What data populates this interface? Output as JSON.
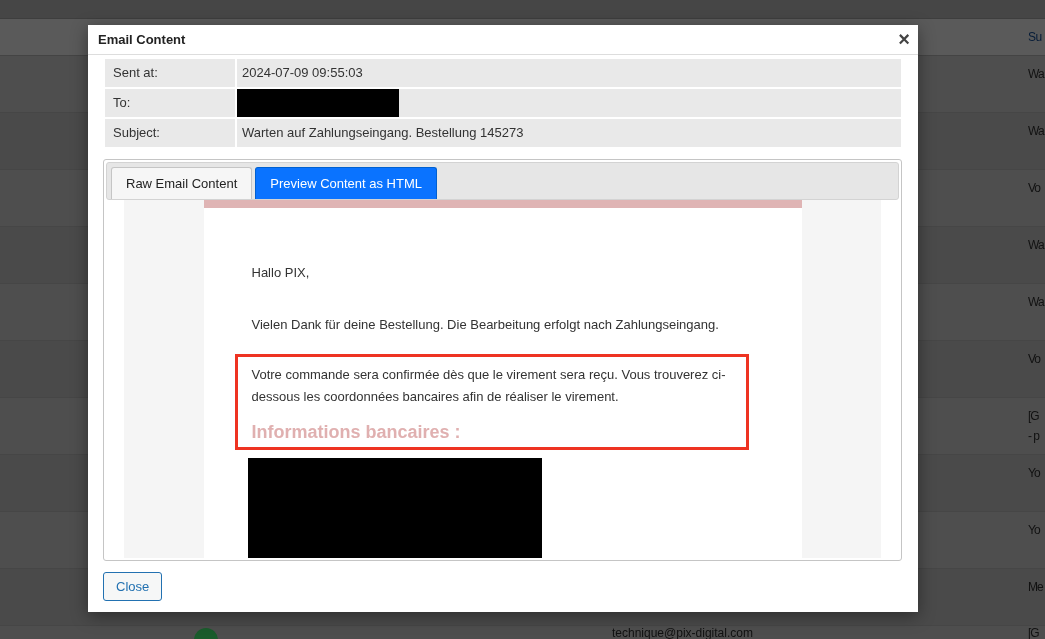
{
  "background_table": {
    "header": "Su",
    "rows": [
      {
        "column_1": "Wa"
      },
      {
        "column_1": "Wa"
      },
      {
        "column_1": "Vo"
      },
      {
        "column_1": "Wa"
      },
      {
        "column_1": "Wa"
      },
      {
        "column_1": "Vo"
      },
      {
        "column_1": "[G\n- p"
      },
      {
        "column_1": "Yo"
      },
      {
        "column_1": "Yo"
      },
      {
        "column_1": "Me"
      },
      {
        "column_1": "[G",
        "email": "technique@pix-digital.com"
      }
    ]
  },
  "dialog": {
    "title": "Email Content",
    "close_icon": "×",
    "fields": [
      {
        "label": "Sent at:",
        "value": "2024-07-09 09:55:03",
        "redacted": false
      },
      {
        "label": "To:",
        "redacted": true
      },
      {
        "label": "Subject:",
        "value": "Warten auf Zahlungseingang. Bestellung 145273",
        "redacted": false
      }
    ],
    "tabs": [
      {
        "label": "Raw Email Content",
        "selected": false
      },
      {
        "label": "Preview Content as HTML",
        "selected": true
      }
    ],
    "email": [
      {
        "kind": "text",
        "text": "Hallo PIX,"
      },
      {
        "kind": "text",
        "text": "Vielen Dank für deine Bestellung. Die Bearbeitung erfolgt nach Zahlungseingang."
      },
      {
        "kind": "highlighted",
        "text": "Votre commande sera confirmée dès que le virement sera reçu. Vous trouverez ci-dessous les coordonnées bancaires afin de réaliser le virement.",
        "heading": "Informations bancaires :"
      },
      {
        "kind": "redacted"
      }
    ],
    "buttons": [
      "Close"
    ]
  }
}
